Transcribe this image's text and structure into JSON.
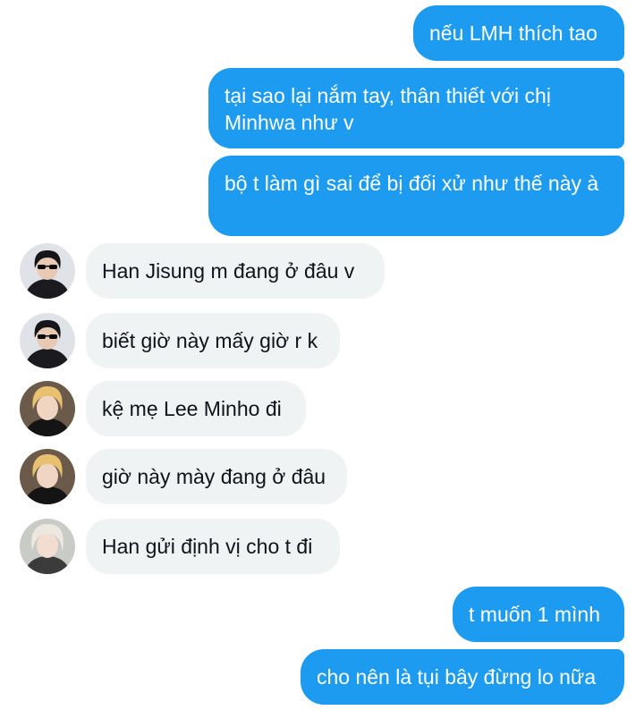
{
  "colors": {
    "outgoing_bubble": "#1d9bf0",
    "incoming_bubble": "#eff3f4",
    "incoming_text": "#0f1419",
    "outgoing_text": "#ffffff"
  },
  "messages": [
    {
      "direction": "outgoing",
      "text": "nếu LMH thích tao"
    },
    {
      "direction": "outgoing",
      "text": "tại sao lại nắm tay, thân thiết với chị Minhwa như v"
    },
    {
      "direction": "outgoing",
      "text": "bộ t làm gì sai để bị đối xử như thế này à"
    },
    {
      "direction": "incoming",
      "avatar_icon": "dark-hair-sunglasses-avatar-icon",
      "text": "Han Jisung m đang ở đâu v"
    },
    {
      "direction": "incoming",
      "avatar_icon": "dark-hair-sunglasses-avatar-icon",
      "text": "biết giờ này mấy giờ r k"
    },
    {
      "direction": "incoming",
      "avatar_icon": "blonde-avatar-icon",
      "text": "kệ mẹ Lee Minho đi"
    },
    {
      "direction": "incoming",
      "avatar_icon": "blonde-avatar-icon",
      "text": "giờ này mày đang ở đâu"
    },
    {
      "direction": "incoming",
      "avatar_icon": "platinum-hair-avatar-icon",
      "text": "Han gửi định vị cho t đi"
    },
    {
      "direction": "outgoing",
      "text": "t muốn 1 mình"
    },
    {
      "direction": "outgoing",
      "text": "cho nên là tụi bây đừng lo nữa"
    }
  ]
}
